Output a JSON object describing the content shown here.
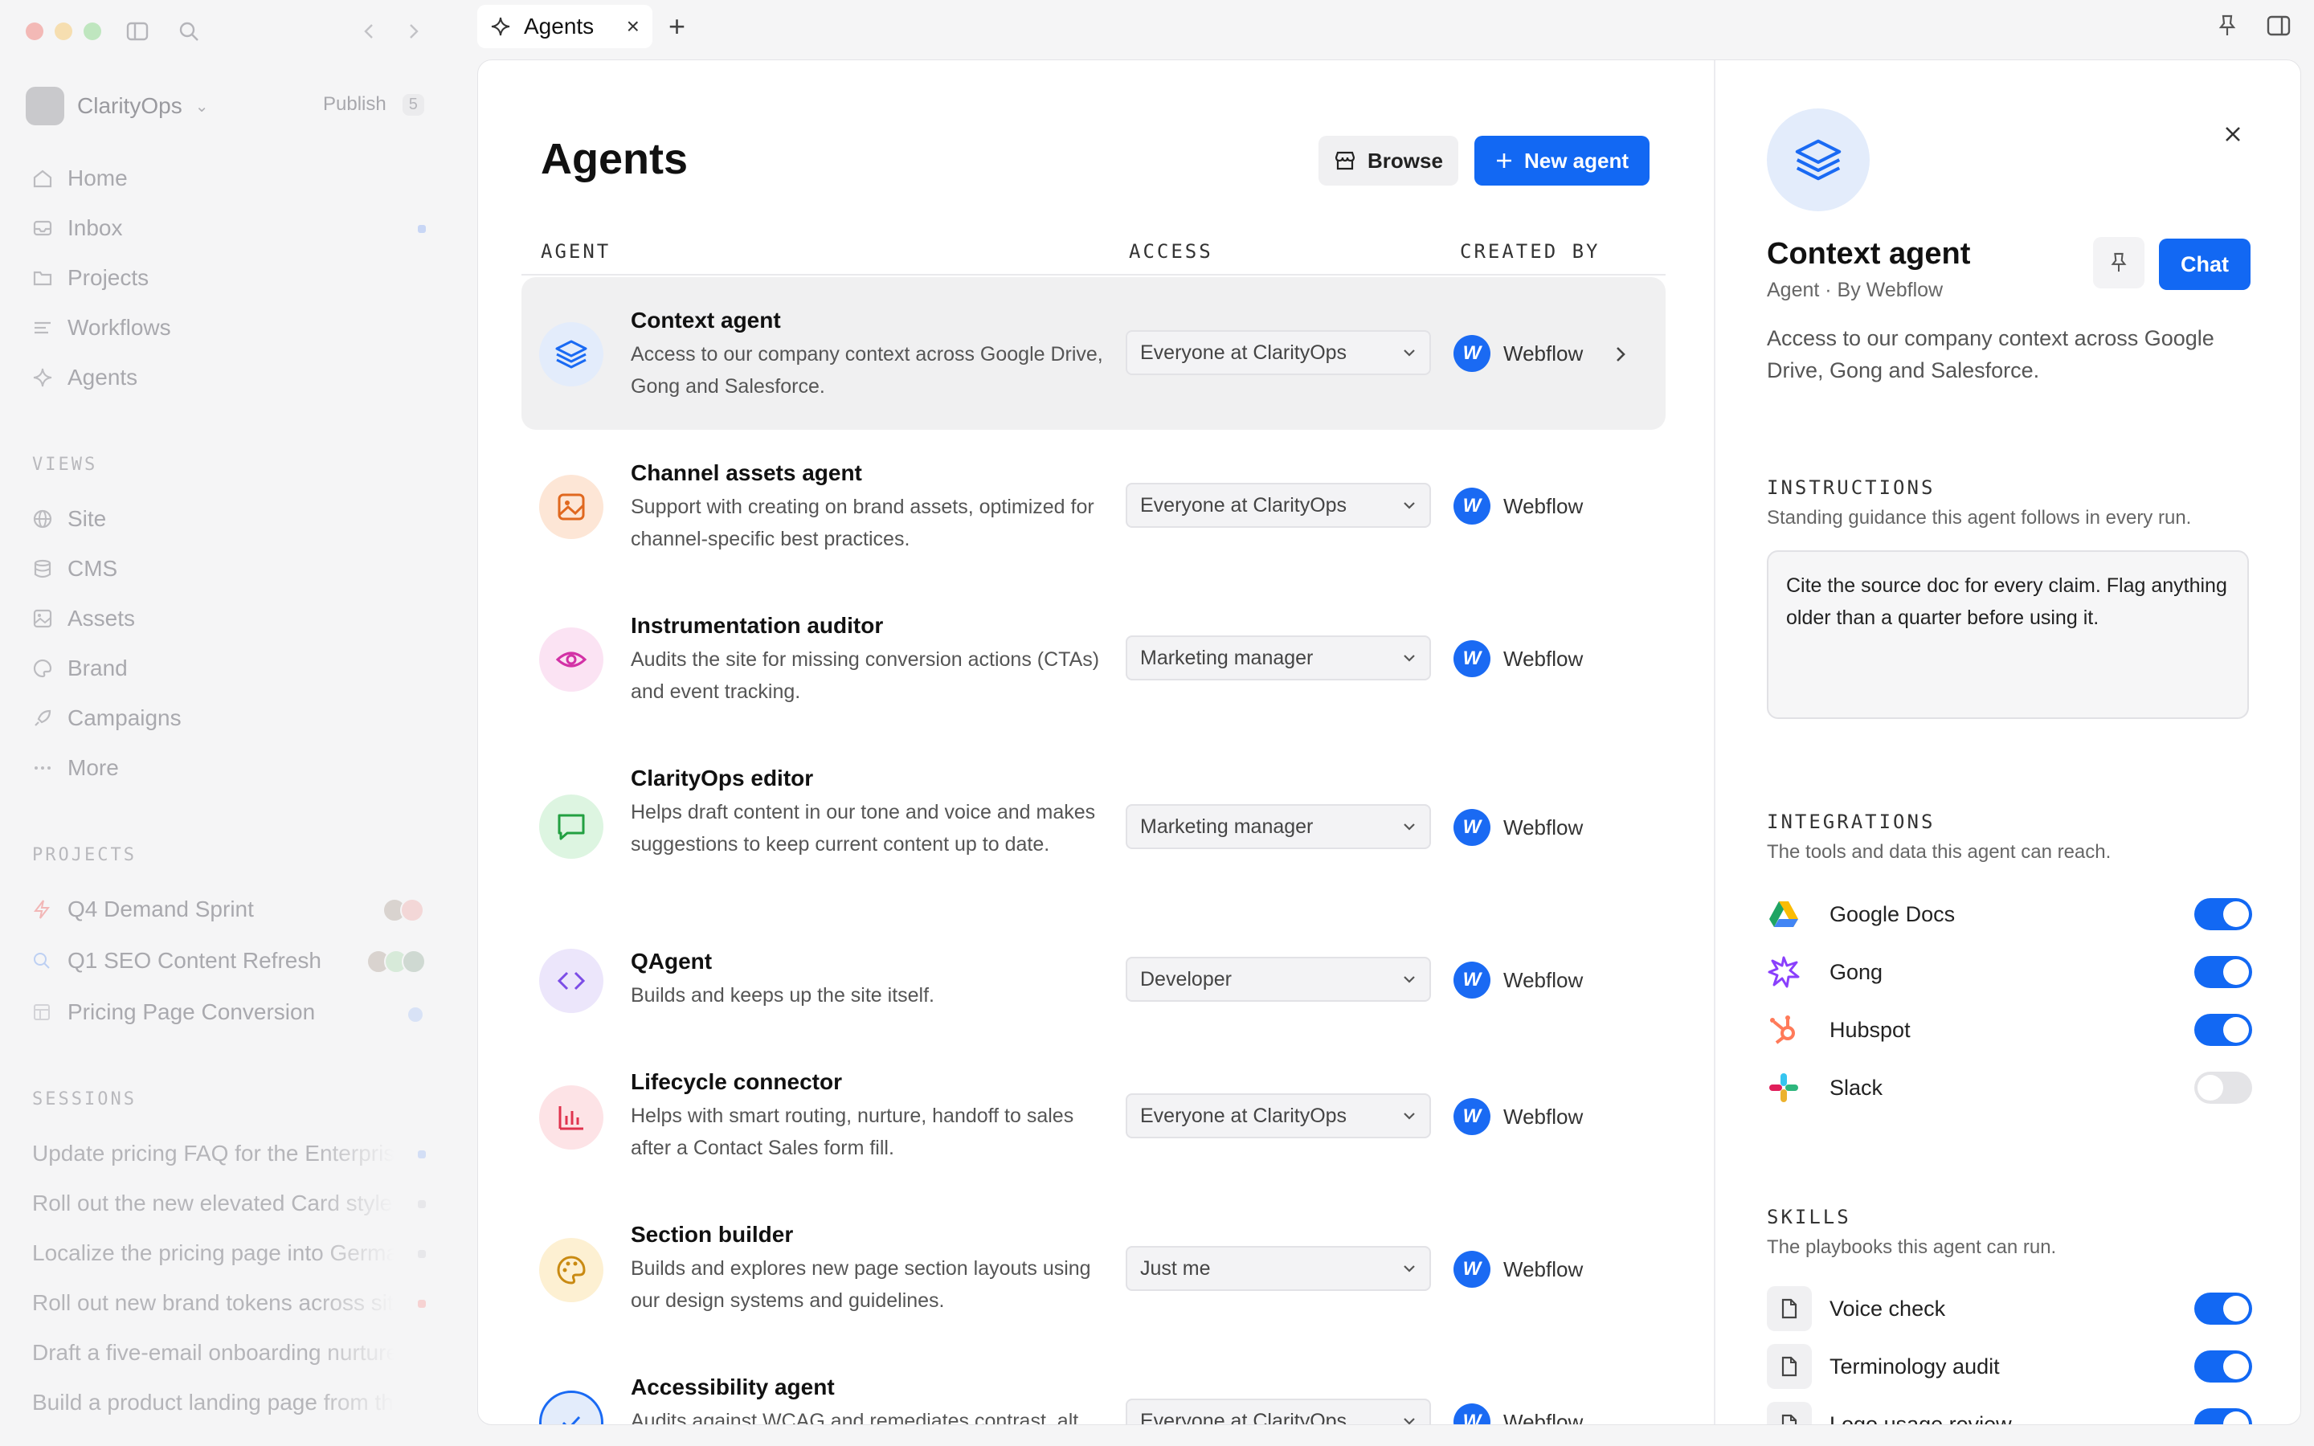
{
  "window": {
    "traffic_colors": [
      "#ff5f57",
      "#febc2e",
      "#28c840"
    ]
  },
  "sidebar": {
    "workspace_name": "ClarityOps",
    "publish_label": "Publish",
    "publish_count": "5",
    "nav": [
      {
        "label": "Home",
        "icon": "home-icon"
      },
      {
        "label": "Inbox",
        "icon": "inbox-icon"
      },
      {
        "label": "Projects",
        "icon": "folder-icon"
      },
      {
        "label": "Workflows",
        "icon": "workflow-icon"
      },
      {
        "label": "Agents",
        "icon": "sparkle-icon"
      }
    ],
    "views_label": "VIEWS",
    "views": [
      {
        "label": "Site",
        "icon": "globe-icon"
      },
      {
        "label": "CMS",
        "icon": "database-icon"
      },
      {
        "label": "Assets",
        "icon": "image-icon"
      },
      {
        "label": "Brand",
        "icon": "palette-icon"
      },
      {
        "label": "Campaigns",
        "icon": "rocket-icon"
      },
      {
        "label": "More",
        "icon": "more-icon"
      }
    ],
    "projects_label": "PROJECTS",
    "projects": [
      {
        "label": "Q4 Demand Sprint",
        "icon": "bolt-icon"
      },
      {
        "label": "Q1 SEO Content Refresh",
        "icon": "search-icon"
      },
      {
        "label": "Pricing Page Conversion",
        "icon": "table-icon"
      }
    ],
    "sessions_label": "SESSIONS",
    "sessions": [
      "Update pricing FAQ for the Enterprise tier",
      "Roll out the new elevated Card styles",
      "Localize the pricing page into German",
      "Roll out new brand tokens across site",
      "Draft a five-email onboarding nurture",
      "Build a product landing page from the brief"
    ]
  },
  "tabs": {
    "active_label": "Agents"
  },
  "main": {
    "title": "Agents",
    "browse_label": "Browse",
    "new_agent_label": "New agent",
    "columns": {
      "agent": "AGENT",
      "access": "ACCESS",
      "created_by": "CREATED BY"
    },
    "agents": [
      {
        "name": "Context agent",
        "desc": "Access to our company context across Google Drive, Gong and Salesforce.",
        "access": "Everyone at ClarityOps",
        "creator": "Webflow",
        "icon": "layers-icon",
        "bg": "#e3ecfb",
        "fg": "#1a6af3"
      },
      {
        "name": "Channel assets agent",
        "desc": "Support with creating on brand assets, optimized for channel-specific best practices.",
        "access": "Everyone at ClarityOps",
        "creator": "Webflow",
        "icon": "image-icon",
        "bg": "#fde6d6",
        "fg": "#e0681f"
      },
      {
        "name": "Instrumentation auditor",
        "desc": "Audits the site for missing conversion actions (CTAs) and event tracking.",
        "access": "Marketing manager",
        "creator": "Webflow",
        "icon": "eye-icon",
        "bg": "#fbe3f3",
        "fg": "#d331a6"
      },
      {
        "name": "ClarityOps editor",
        "desc": "Helps draft content in our tone and voice and makes suggestions to keep current content up to date.",
        "access": "Marketing manager",
        "creator": "Webflow",
        "icon": "chat-icon",
        "bg": "#ddf5e1",
        "fg": "#22a041"
      },
      {
        "name": "QAgent",
        "desc": "Builds and keeps up the site itself.",
        "access": "Developer",
        "creator": "Webflow",
        "icon": "code-icon",
        "bg": "#ece6fb",
        "fg": "#7c4de6"
      },
      {
        "name": "Lifecycle connector",
        "desc": "Helps with smart routing, nurture, handoff to sales after a Contact Sales form fill.",
        "access": "Everyone at ClarityOps",
        "creator": "Webflow",
        "icon": "bar-chart-icon",
        "bg": "#fde3e6",
        "fg": "#e0334e"
      },
      {
        "name": "Section builder",
        "desc": "Builds and explores new page section layouts using our design systems and guidelines.",
        "access": "Just me",
        "creator": "Webflow",
        "icon": "palette-icon",
        "bg": "#fdf0d2",
        "fg": "#c98a12"
      },
      {
        "name": "Accessibility agent",
        "desc": "Audits against WCAG and remediates contrast, alt text and focus issues.",
        "access": "Everyone at ClarityOps",
        "creator": "Webflow",
        "icon": "check-circle-icon",
        "bg": "#e3ecfb",
        "fg": "#1a6af3"
      }
    ]
  },
  "detail": {
    "title": "Context agent",
    "subtitle": "Agent · By Webflow",
    "chat_label": "Chat",
    "description": "Access to our company context across Google Drive, Gong and Salesforce.",
    "instructions_label": "INSTRUCTIONS",
    "instructions_help": "Standing guidance this agent follows in every run.",
    "instructions_text": "Cite the source doc for every claim. Flag anything older than a quarter before using it.",
    "integrations_label": "INTEGRATIONS",
    "integrations_help": "The tools and data this agent can reach.",
    "integrations": [
      {
        "name": "Google Docs",
        "enabled": true,
        "icon": "google-drive-icon"
      },
      {
        "name": "Gong",
        "enabled": true,
        "icon": "gong-icon"
      },
      {
        "name": "Hubspot",
        "enabled": true,
        "icon": "hubspot-icon"
      },
      {
        "name": "Slack",
        "enabled": false,
        "icon": "slack-icon"
      }
    ],
    "skills_label": "SKILLS",
    "skills_help": "The playbooks this agent can run.",
    "skills": [
      {
        "name": "Voice check",
        "enabled": true
      },
      {
        "name": "Terminology audit",
        "enabled": true
      },
      {
        "name": "Logo usage review",
        "enabled": true
      }
    ]
  },
  "colors": {
    "accent": "#1268f3",
    "sidebar_bg": "#f5f5f6"
  }
}
